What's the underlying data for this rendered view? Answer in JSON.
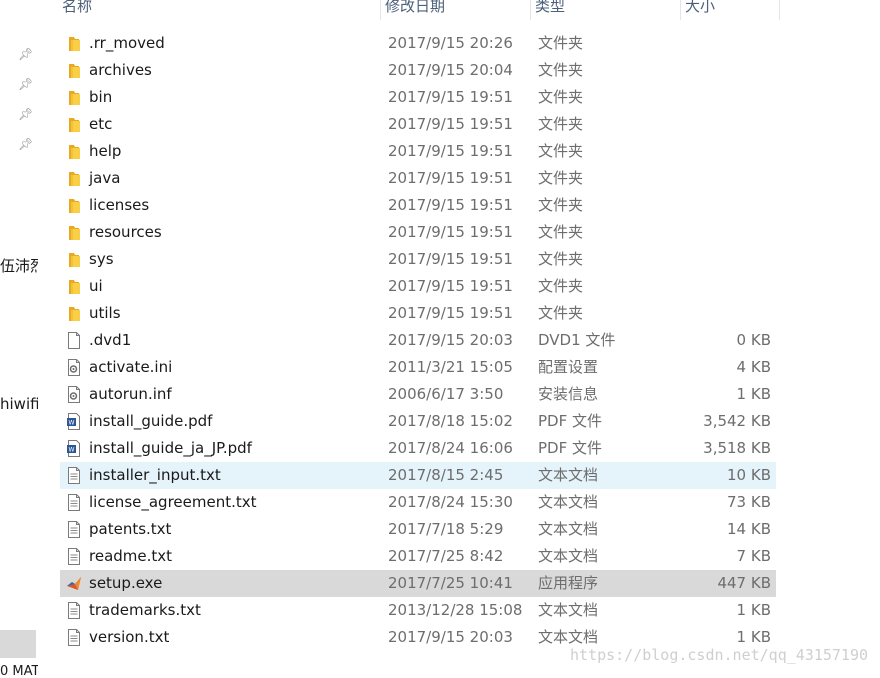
{
  "left_nav": {
    "fragment_1": "伍沛烈",
    "fragment_2": "hiwifi",
    "fragment_3": "0 MAT"
  },
  "columns": {
    "name": "名称",
    "date": "修改日期",
    "type": "类型",
    "size": "大小"
  },
  "files": [
    {
      "name": ".rr_moved",
      "date": "2017/9/15 20:26",
      "type": "文件夹",
      "size": "",
      "icon": "folder-icon"
    },
    {
      "name": "archives",
      "date": "2017/9/15 20:04",
      "type": "文件夹",
      "size": "",
      "icon": "folder-icon"
    },
    {
      "name": "bin",
      "date": "2017/9/15 19:51",
      "type": "文件夹",
      "size": "",
      "icon": "folder-icon"
    },
    {
      "name": "etc",
      "date": "2017/9/15 19:51",
      "type": "文件夹",
      "size": "",
      "icon": "folder-icon"
    },
    {
      "name": "help",
      "date": "2017/9/15 19:51",
      "type": "文件夹",
      "size": "",
      "icon": "folder-icon"
    },
    {
      "name": "java",
      "date": "2017/9/15 19:51",
      "type": "文件夹",
      "size": "",
      "icon": "folder-icon"
    },
    {
      "name": "licenses",
      "date": "2017/9/15 19:51",
      "type": "文件夹",
      "size": "",
      "icon": "folder-icon"
    },
    {
      "name": "resources",
      "date": "2017/9/15 19:51",
      "type": "文件夹",
      "size": "",
      "icon": "folder-icon"
    },
    {
      "name": "sys",
      "date": "2017/9/15 19:51",
      "type": "文件夹",
      "size": "",
      "icon": "folder-icon"
    },
    {
      "name": "ui",
      "date": "2017/9/15 19:51",
      "type": "文件夹",
      "size": "",
      "icon": "folder-icon"
    },
    {
      "name": "utils",
      "date": "2017/9/15 19:51",
      "type": "文件夹",
      "size": "",
      "icon": "folder-icon"
    },
    {
      "name": ".dvd1",
      "date": "2017/9/15 20:03",
      "type": "DVD1 文件",
      "size": "0 KB",
      "icon": "blank-file-icon"
    },
    {
      "name": "activate.ini",
      "date": "2011/3/21 15:05",
      "type": "配置设置",
      "size": "4 KB",
      "icon": "settings-file-icon"
    },
    {
      "name": "autorun.inf",
      "date": "2006/6/17 3:50",
      "type": "安装信息",
      "size": "1 KB",
      "icon": "settings-file-icon"
    },
    {
      "name": "install_guide.pdf",
      "date": "2017/8/18 15:02",
      "type": "PDF 文件",
      "size": "3,542 KB",
      "icon": "pdf-file-icon"
    },
    {
      "name": "install_guide_ja_JP.pdf",
      "date": "2017/8/24 16:06",
      "type": "PDF 文件",
      "size": "3,518 KB",
      "icon": "pdf-file-icon"
    },
    {
      "name": "installer_input.txt",
      "date": "2017/8/15 2:45",
      "type": "文本文档",
      "size": "10 KB",
      "icon": "text-file-icon",
      "state": "hover"
    },
    {
      "name": "license_agreement.txt",
      "date": "2017/8/24 15:30",
      "type": "文本文档",
      "size": "73 KB",
      "icon": "text-file-icon"
    },
    {
      "name": "patents.txt",
      "date": "2017/7/18 5:29",
      "type": "文本文档",
      "size": "14 KB",
      "icon": "text-file-icon"
    },
    {
      "name": "readme.txt",
      "date": "2017/7/25 8:42",
      "type": "文本文档",
      "size": "7 KB",
      "icon": "text-file-icon"
    },
    {
      "name": "setup.exe",
      "date": "2017/7/25 10:41",
      "type": "应用程序",
      "size": "447 KB",
      "icon": "matlab-app-icon",
      "state": "selected"
    },
    {
      "name": "trademarks.txt",
      "date": "2013/12/28 15:08",
      "type": "文本文档",
      "size": "1 KB",
      "icon": "text-file-icon"
    },
    {
      "name": "version.txt",
      "date": "2017/9/15 20:03",
      "type": "文本文档",
      "size": "1 KB",
      "icon": "text-file-icon"
    }
  ],
  "watermark": "https://blog.csdn.net/qq_43157190",
  "colors": {
    "hover_row": "#e5f3fb",
    "selected_row": "#d9d9d9",
    "folder_yellow": "#f3c237",
    "header_text": "#4c607a"
  }
}
